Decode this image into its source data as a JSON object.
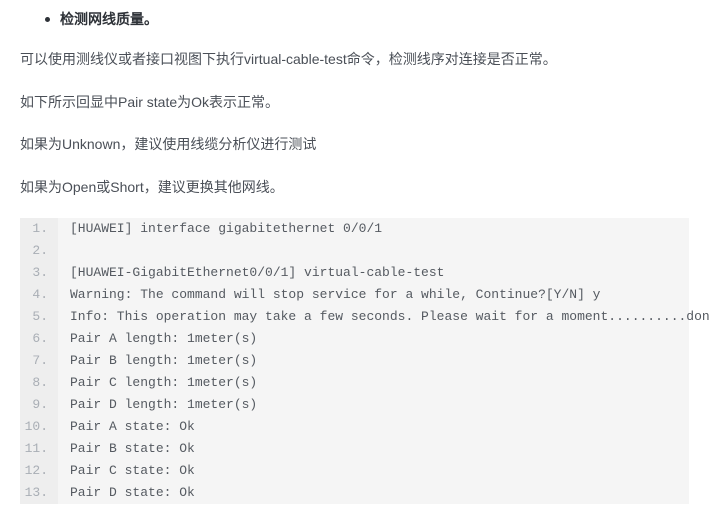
{
  "heading": {
    "text": "检测网线质量。"
  },
  "paras": [
    "可以使用测线仪或者接口视图下执行virtual-cable-test命令，检测线序对连接是否正常。",
    "如下所示回显中Pair state为Ok表示正常。",
    "如果为Unknown，建议使用线缆分析仪进行测试",
    "如果为Open或Short，建议更换其他网线。"
  ],
  "code": {
    "lines": [
      "[HUAWEI] interface gigabitethernet 0/0/1",
      "",
      "[HUAWEI-GigabitEthernet0/0/1] virtual-cable-test",
      "Warning: The command will stop service for a while, Continue?[Y/N] y",
      "Info: This operation may take a few seconds. Please wait for a moment..........done.",
      "Pair A length: 1meter(s)",
      "Pair B length: 1meter(s)",
      "Pair C length: 1meter(s)",
      "Pair D length: 1meter(s)",
      "Pair A state: Ok",
      "Pair B state: Ok",
      "Pair C state: Ok",
      "Pair D state: Ok"
    ]
  }
}
